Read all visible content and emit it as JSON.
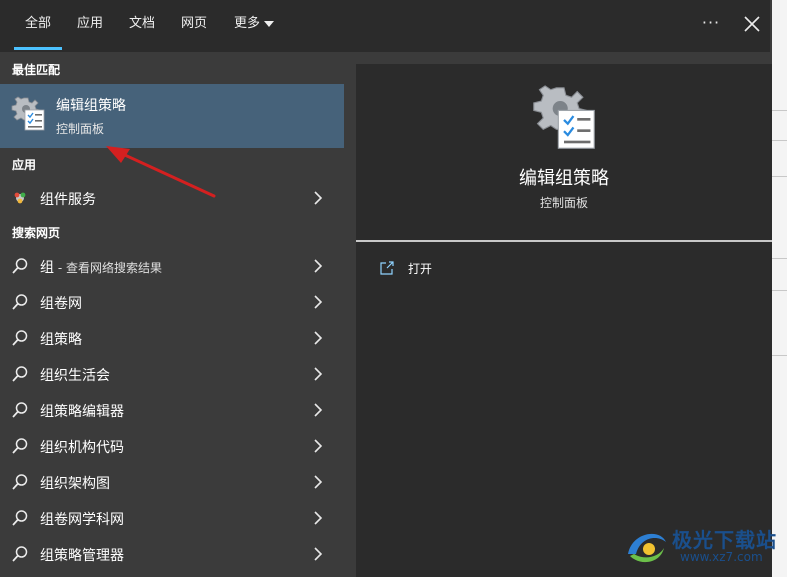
{
  "tabs": [
    {
      "label": "全部",
      "active": true
    },
    {
      "label": "应用",
      "active": false
    },
    {
      "label": "文档",
      "active": false
    },
    {
      "label": "网页",
      "active": false
    },
    {
      "label": "更多",
      "active": false
    }
  ],
  "topbar": {
    "more_options": "···"
  },
  "best_match": {
    "section_title": "最佳匹配",
    "title": "编辑组策略",
    "subtitle": "控制面板",
    "icon": "group-policy-gear-icon"
  },
  "apps": {
    "section_title": "应用",
    "items": [
      {
        "label": "组件服务",
        "icon": "component-services-icon"
      }
    ]
  },
  "web": {
    "section_title": "搜索网页",
    "items": [
      {
        "label": "组",
        "suffix": " - 查看网络搜索结果"
      },
      {
        "label": "组卷网",
        "suffix": ""
      },
      {
        "label": "组策略",
        "suffix": ""
      },
      {
        "label": "组织生活会",
        "suffix": ""
      },
      {
        "label": "组策略编辑器",
        "suffix": ""
      },
      {
        "label": "组织机构代码",
        "suffix": ""
      },
      {
        "label": "组织架构图",
        "suffix": ""
      },
      {
        "label": "组卷网学科网",
        "suffix": ""
      },
      {
        "label": "组策略管理器",
        "suffix": ""
      }
    ]
  },
  "detail": {
    "title": "编辑组策略",
    "subtitle": "控制面板",
    "actions": [
      {
        "label": "打开",
        "icon": "open-icon"
      }
    ]
  },
  "watermark": {
    "line1": "极光下载站",
    "line2": "www.xz7.com"
  },
  "colors": {
    "accent": "#4cc2ff",
    "selection": "#46627a",
    "panel_dark": "#2b2b2b",
    "panel": "#3b3b3b",
    "annotation_arrow": "#d42020"
  }
}
